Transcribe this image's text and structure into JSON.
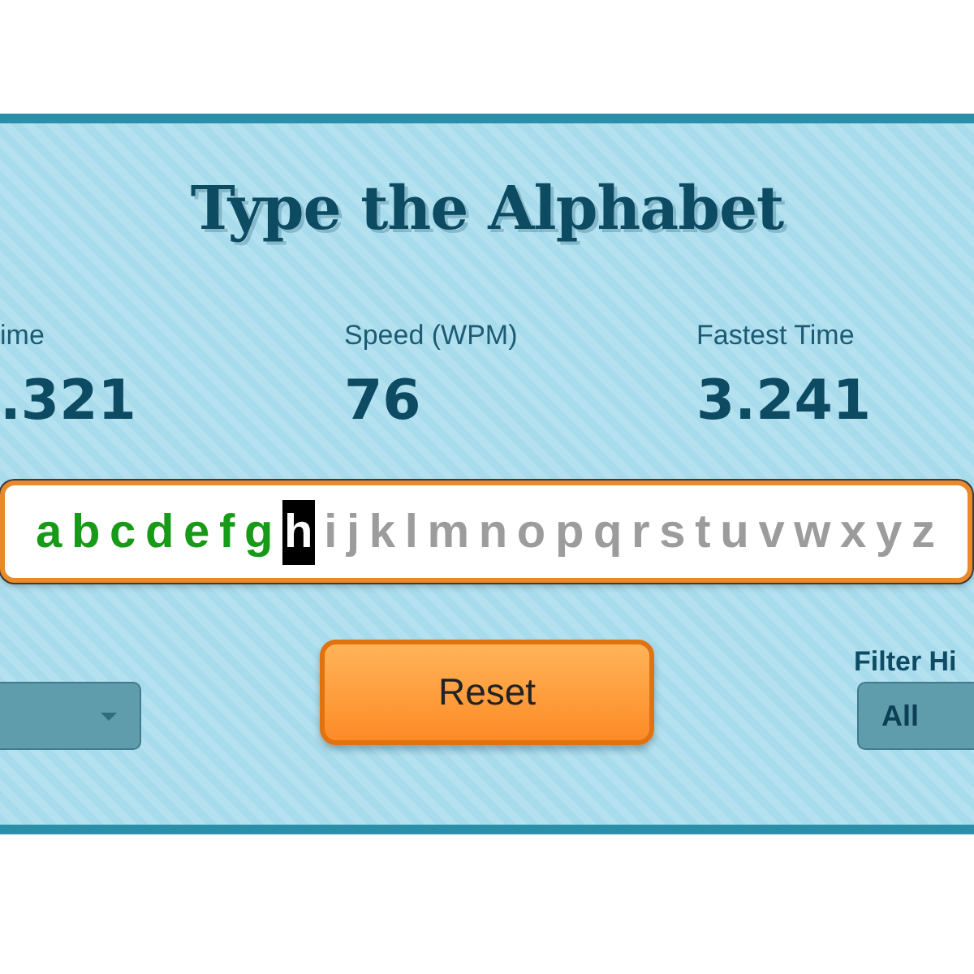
{
  "title": "Type the Alphabet",
  "stats": [
    {
      "label": "ime",
      "value": ".321"
    },
    {
      "label": "Speed (WPM)",
      "value": "76"
    },
    {
      "label": "Fastest Time",
      "value": "3.241"
    }
  ],
  "letters": [
    {
      "char": "a",
      "typed": true,
      "current": false
    },
    {
      "char": "b",
      "typed": true,
      "current": false
    },
    {
      "char": "c",
      "typed": true,
      "current": false
    },
    {
      "char": "d",
      "typed": true,
      "current": false
    },
    {
      "char": "e",
      "typed": true,
      "current": false
    },
    {
      "char": "f",
      "typed": true,
      "current": false
    },
    {
      "char": "g",
      "typed": true,
      "current": false
    },
    {
      "char": "h",
      "typed": false,
      "current": true
    },
    {
      "char": "i",
      "typed": false,
      "current": false
    },
    {
      "char": "j",
      "typed": false,
      "current": false
    },
    {
      "char": "k",
      "typed": false,
      "current": false
    },
    {
      "char": "l",
      "typed": false,
      "current": false
    },
    {
      "char": "m",
      "typed": false,
      "current": false
    },
    {
      "char": "n",
      "typed": false,
      "current": false
    },
    {
      "char": "o",
      "typed": false,
      "current": false
    },
    {
      "char": "p",
      "typed": false,
      "current": false
    },
    {
      "char": "q",
      "typed": false,
      "current": false
    },
    {
      "char": "r",
      "typed": false,
      "current": false
    },
    {
      "char": "s",
      "typed": false,
      "current": false
    },
    {
      "char": "t",
      "typed": false,
      "current": false
    },
    {
      "char": "u",
      "typed": false,
      "current": false
    },
    {
      "char": "v",
      "typed": false,
      "current": false
    },
    {
      "char": "w",
      "typed": false,
      "current": false
    },
    {
      "char": "x",
      "typed": false,
      "current": false
    },
    {
      "char": "y",
      "typed": false,
      "current": false
    },
    {
      "char": "z",
      "typed": false,
      "current": false
    }
  ],
  "reset_button": "Reset",
  "filter": {
    "label": "Filter Hi",
    "value": "All"
  }
}
